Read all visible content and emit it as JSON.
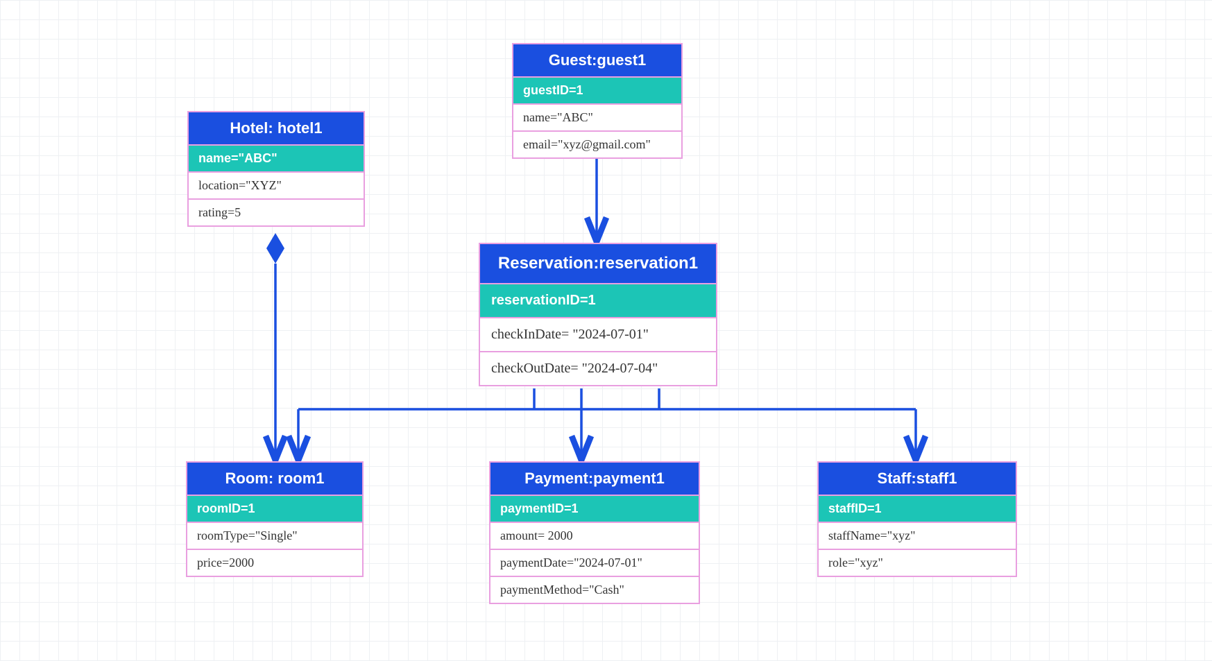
{
  "diagram_type": "UML Object Diagram",
  "colors": {
    "title_bg": "#1a4fe0",
    "key_bg": "#1cc5b6",
    "border": "#e99fe0",
    "connector": "#1a4fe0",
    "grid": "#eef0f3"
  },
  "entities": {
    "hotel": {
      "title": "Hotel: hotel1",
      "key": "name=\"ABC\"",
      "attrs": [
        "location=\"XYZ\"",
        "rating=5"
      ]
    },
    "guest": {
      "title": "Guest:guest1",
      "key": "guestID=1",
      "attrs": [
        "name=\"ABC\"",
        "email=\"xyz@gmail.com\""
      ]
    },
    "reservation": {
      "title": "Reservation:reservation1",
      "key": "reservationID=1",
      "attrs": [
        "checkInDate= \"2024-07-01\"",
        "checkOutDate= \"2024-07-04\""
      ]
    },
    "room": {
      "title": "Room: room1",
      "key": "roomID=1",
      "attrs": [
        "roomType=\"Single\"",
        "price=2000"
      ]
    },
    "payment": {
      "title": "Payment:payment1",
      "key": "paymentID=1",
      "attrs": [
        "amount= 2000",
        "paymentDate=\"2024-07-01\"",
        "paymentMethod=\"Cash\""
      ]
    },
    "staff": {
      "title": "Staff:staff1",
      "key": "staffID=1",
      "attrs": [
        "staffName=\"xyz\"",
        "role=\"xyz\""
      ]
    }
  },
  "relations": [
    {
      "from": "hotel",
      "to": "room",
      "type": "aggregation"
    },
    {
      "from": "guest",
      "to": "reservation",
      "type": "association"
    },
    {
      "from": "reservation",
      "to": "room",
      "type": "association"
    },
    {
      "from": "reservation",
      "to": "payment",
      "type": "association"
    },
    {
      "from": "reservation",
      "to": "staff",
      "type": "association"
    }
  ]
}
